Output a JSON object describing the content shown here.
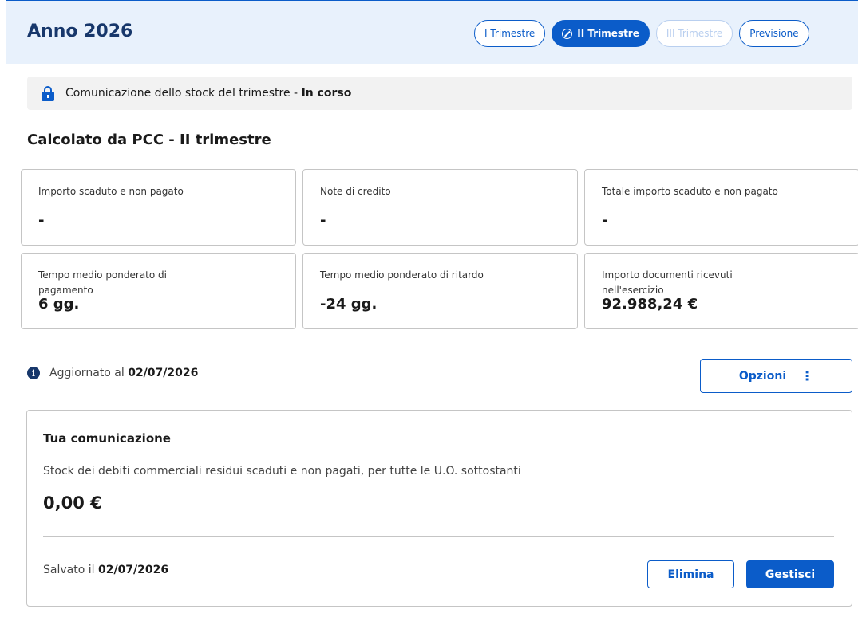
{
  "header": {
    "title": "Anno 2026",
    "tabs": [
      {
        "label": "I Trimestre",
        "state": "default"
      },
      {
        "label": "II Trimestre",
        "state": "active"
      },
      {
        "label": "III Trimestre",
        "state": "disabled"
      },
      {
        "label": "Previsione",
        "state": "default"
      }
    ]
  },
  "status": {
    "text": "Comunicazione dello stock del trimestre",
    "separator": " - ",
    "state": "In corso"
  },
  "section": {
    "title": "Calcolato da PCC - II trimestre"
  },
  "cards": [
    {
      "label": "Importo scaduto e non pagato",
      "value": "-"
    },
    {
      "label": "Note di credito",
      "value": "-"
    },
    {
      "label": "Totale importo scaduto e non pagato",
      "value": "-"
    },
    {
      "label": "Tempo medio ponderato di pagamento",
      "value": "6 gg."
    },
    {
      "label": "Tempo medio ponderato di ritardo",
      "value": "-24 gg."
    },
    {
      "label": "Importo documenti ricevuti nell'esercizio",
      "value": "92.988,24 €"
    }
  ],
  "updated": {
    "prefix": "Aggiornato al",
    "date": "02/07/2026"
  },
  "options": {
    "label": "Opzioni"
  },
  "communication": {
    "title": "Tua comunicazione",
    "description": "Stock dei debiti commerciali residui scaduti e non pagati, per tutte le U.O. sottostanti",
    "amount": "0,00 €",
    "saved_prefix": "Salvato il",
    "saved_date": "02/07/2026",
    "delete_label": "Elimina",
    "manage_label": "Gestisci"
  },
  "colors": {
    "primary": "#0b5cc9",
    "header_bg": "#e8f1fc",
    "title": "#17376b"
  }
}
